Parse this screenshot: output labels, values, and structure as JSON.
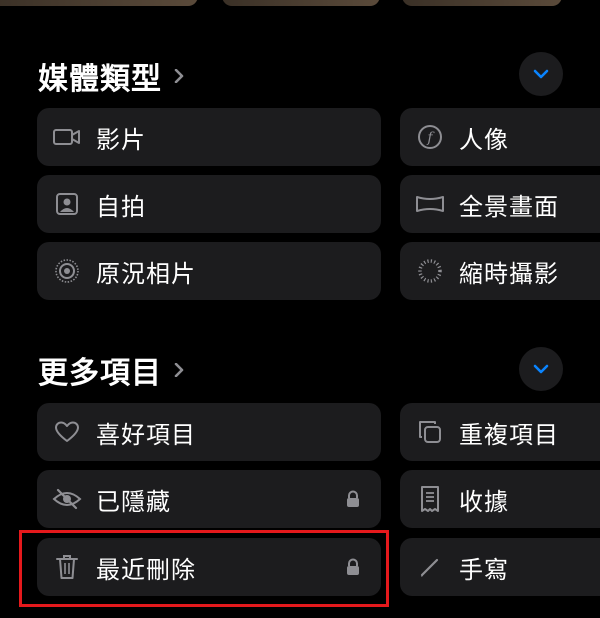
{
  "media_types": {
    "title": "媒體類型",
    "items": [
      {
        "label": "影片",
        "icon": "video-icon"
      },
      {
        "label": "人像",
        "icon": "portrait-f-icon"
      },
      {
        "label": "自拍",
        "icon": "selfie-icon"
      },
      {
        "label": "全景畫面",
        "icon": "panorama-icon"
      },
      {
        "label": "原況相片",
        "icon": "live-photo-icon"
      },
      {
        "label": "縮時攝影",
        "icon": "timelapse-icon"
      }
    ]
  },
  "more_items": {
    "title": "更多項目",
    "items": [
      {
        "label": "喜好項目",
        "icon": "heart-icon"
      },
      {
        "label": "重複項目",
        "icon": "duplicate-icon"
      },
      {
        "label": "已隱藏",
        "icon": "eye-slash-icon",
        "locked": true
      },
      {
        "label": "收據",
        "icon": "receipt-icon"
      },
      {
        "label": "最近刪除",
        "icon": "trash-icon",
        "locked": true
      },
      {
        "label": "手寫",
        "icon": "pencil-icon"
      }
    ]
  },
  "colors": {
    "background": "#000000",
    "tile": "#1c1c1e",
    "accent": "#0a84ff",
    "highlight": "#e5191c"
  }
}
